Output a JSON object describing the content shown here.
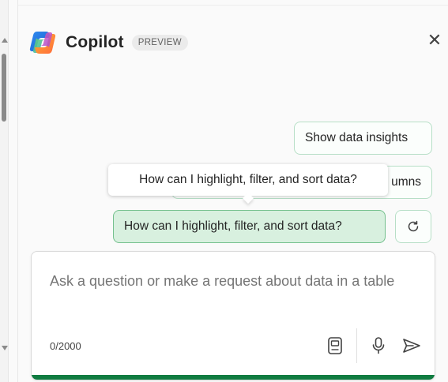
{
  "header": {
    "title": "Copilot",
    "badge": "PREVIEW",
    "logo_icon": "copilot-logo-icon",
    "close_icon": "close-icon",
    "close_glyph": "✕"
  },
  "suggestions": [
    {
      "label": "Show data insights"
    },
    {
      "label": "umns"
    },
    {
      "label": "How can I highlight, filter, and sort data?",
      "state": "hovered"
    }
  ],
  "refresh_icon": "refresh-icon",
  "tooltip": {
    "text": "How can I highlight, filter, and sort data?"
  },
  "composer": {
    "placeholder": "Ask a question or make a request about data in a table",
    "value": "",
    "char_count": "0/2000",
    "tools": [
      "prompt-guide-icon",
      "microphone-icon",
      "send-icon"
    ]
  },
  "colors": {
    "accent_green": "#107c41",
    "chip_border": "#b7dfc7",
    "chip_hover_bg": "#d8f0df"
  }
}
